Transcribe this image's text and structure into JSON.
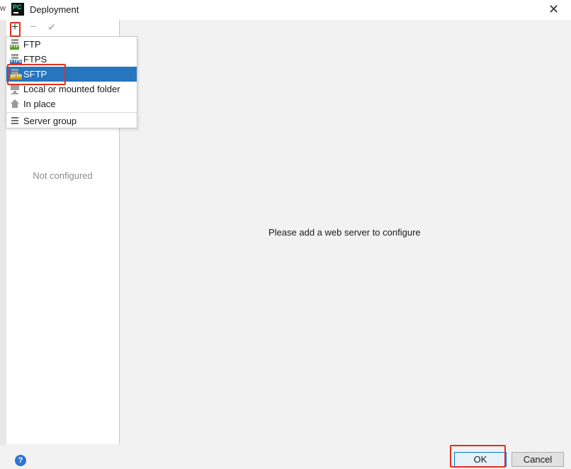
{
  "window": {
    "title": "Deployment",
    "app_icon_text": "PC",
    "close_glyph": "✕",
    "edge_char": "w"
  },
  "toolbar": {
    "add_glyph": "+",
    "remove_glyph": "−",
    "apply_glyph": "✔"
  },
  "add_menu": {
    "items": [
      {
        "label": "FTP",
        "icon": "ftp-server-icon",
        "tag": "FTP",
        "tag_color": "#5b9b2f"
      },
      {
        "label": "FTPS",
        "icon": "ftps-server-icon",
        "tag": "FTPS",
        "tag_color": "#2f6fb5"
      },
      {
        "label": "SFTP",
        "icon": "sftp-server-icon",
        "tag": "SFTP",
        "tag_color": "#c99a1d",
        "selected": true
      },
      {
        "label": "Local or mounted folder",
        "icon": "monitor-icon"
      },
      {
        "label": "In place",
        "icon": "house-icon"
      },
      {
        "label": "Server group",
        "icon": "server-group-icon"
      }
    ]
  },
  "server_list": {
    "empty_text": "Not configured"
  },
  "main": {
    "empty_message": "Please add a web server to configure"
  },
  "footer": {
    "help_glyph": "?",
    "ok_label": "OK",
    "cancel_label": "Cancel"
  },
  "colors": {
    "selection": "#2675bf",
    "highlight": "#e0301e",
    "help": "#2f73d4"
  }
}
